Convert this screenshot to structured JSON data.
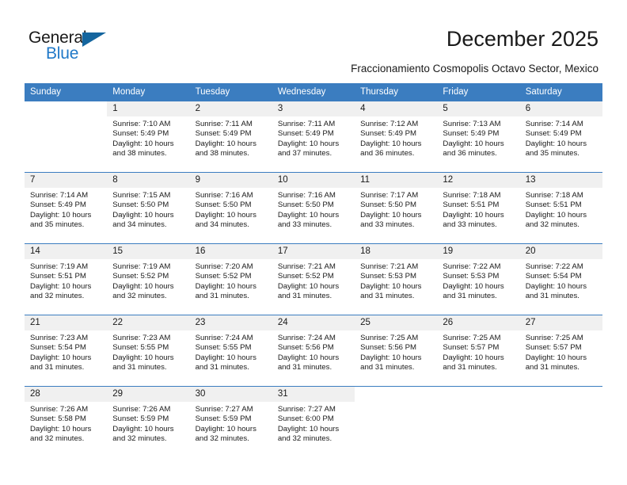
{
  "brand": {
    "name_top": "General",
    "name_bottom": "Blue",
    "accent_color": "#2079c8",
    "triangle_color": "#14659e"
  },
  "header": {
    "title": "December 2025",
    "subtitle": "Fraccionamiento Cosmopolis Octavo Sector, Mexico"
  },
  "theme": {
    "header_bg": "#3b7dc0",
    "header_text": "#ffffff",
    "daynum_bg": "#f0f0f0",
    "grid_line": "#3b7dc0",
    "text": "#1a1a1a"
  },
  "weekdays": [
    "Sunday",
    "Monday",
    "Tuesday",
    "Wednesday",
    "Thursday",
    "Friday",
    "Saturday"
  ],
  "weeks": [
    [
      {
        "day": "",
        "sunrise": "",
        "sunset": "",
        "daylight_line1": "",
        "daylight_line2": ""
      },
      {
        "day": "1",
        "sunrise": "Sunrise: 7:10 AM",
        "sunset": "Sunset: 5:49 PM",
        "daylight_line1": "Daylight: 10 hours",
        "daylight_line2": "and 38 minutes."
      },
      {
        "day": "2",
        "sunrise": "Sunrise: 7:11 AM",
        "sunset": "Sunset: 5:49 PM",
        "daylight_line1": "Daylight: 10 hours",
        "daylight_line2": "and 38 minutes."
      },
      {
        "day": "3",
        "sunrise": "Sunrise: 7:11 AM",
        "sunset": "Sunset: 5:49 PM",
        "daylight_line1": "Daylight: 10 hours",
        "daylight_line2": "and 37 minutes."
      },
      {
        "day": "4",
        "sunrise": "Sunrise: 7:12 AM",
        "sunset": "Sunset: 5:49 PM",
        "daylight_line1": "Daylight: 10 hours",
        "daylight_line2": "and 36 minutes."
      },
      {
        "day": "5",
        "sunrise": "Sunrise: 7:13 AM",
        "sunset": "Sunset: 5:49 PM",
        "daylight_line1": "Daylight: 10 hours",
        "daylight_line2": "and 36 minutes."
      },
      {
        "day": "6",
        "sunrise": "Sunrise: 7:14 AM",
        "sunset": "Sunset: 5:49 PM",
        "daylight_line1": "Daylight: 10 hours",
        "daylight_line2": "and 35 minutes."
      }
    ],
    [
      {
        "day": "7",
        "sunrise": "Sunrise: 7:14 AM",
        "sunset": "Sunset: 5:49 PM",
        "daylight_line1": "Daylight: 10 hours",
        "daylight_line2": "and 35 minutes."
      },
      {
        "day": "8",
        "sunrise": "Sunrise: 7:15 AM",
        "sunset": "Sunset: 5:50 PM",
        "daylight_line1": "Daylight: 10 hours",
        "daylight_line2": "and 34 minutes."
      },
      {
        "day": "9",
        "sunrise": "Sunrise: 7:16 AM",
        "sunset": "Sunset: 5:50 PM",
        "daylight_line1": "Daylight: 10 hours",
        "daylight_line2": "and 34 minutes."
      },
      {
        "day": "10",
        "sunrise": "Sunrise: 7:16 AM",
        "sunset": "Sunset: 5:50 PM",
        "daylight_line1": "Daylight: 10 hours",
        "daylight_line2": "and 33 minutes."
      },
      {
        "day": "11",
        "sunrise": "Sunrise: 7:17 AM",
        "sunset": "Sunset: 5:50 PM",
        "daylight_line1": "Daylight: 10 hours",
        "daylight_line2": "and 33 minutes."
      },
      {
        "day": "12",
        "sunrise": "Sunrise: 7:18 AM",
        "sunset": "Sunset: 5:51 PM",
        "daylight_line1": "Daylight: 10 hours",
        "daylight_line2": "and 33 minutes."
      },
      {
        "day": "13",
        "sunrise": "Sunrise: 7:18 AM",
        "sunset": "Sunset: 5:51 PM",
        "daylight_line1": "Daylight: 10 hours",
        "daylight_line2": "and 32 minutes."
      }
    ],
    [
      {
        "day": "14",
        "sunrise": "Sunrise: 7:19 AM",
        "sunset": "Sunset: 5:51 PM",
        "daylight_line1": "Daylight: 10 hours",
        "daylight_line2": "and 32 minutes."
      },
      {
        "day": "15",
        "sunrise": "Sunrise: 7:19 AM",
        "sunset": "Sunset: 5:52 PM",
        "daylight_line1": "Daylight: 10 hours",
        "daylight_line2": "and 32 minutes."
      },
      {
        "day": "16",
        "sunrise": "Sunrise: 7:20 AM",
        "sunset": "Sunset: 5:52 PM",
        "daylight_line1": "Daylight: 10 hours",
        "daylight_line2": "and 31 minutes."
      },
      {
        "day": "17",
        "sunrise": "Sunrise: 7:21 AM",
        "sunset": "Sunset: 5:52 PM",
        "daylight_line1": "Daylight: 10 hours",
        "daylight_line2": "and 31 minutes."
      },
      {
        "day": "18",
        "sunrise": "Sunrise: 7:21 AM",
        "sunset": "Sunset: 5:53 PM",
        "daylight_line1": "Daylight: 10 hours",
        "daylight_line2": "and 31 minutes."
      },
      {
        "day": "19",
        "sunrise": "Sunrise: 7:22 AM",
        "sunset": "Sunset: 5:53 PM",
        "daylight_line1": "Daylight: 10 hours",
        "daylight_line2": "and 31 minutes."
      },
      {
        "day": "20",
        "sunrise": "Sunrise: 7:22 AM",
        "sunset": "Sunset: 5:54 PM",
        "daylight_line1": "Daylight: 10 hours",
        "daylight_line2": "and 31 minutes."
      }
    ],
    [
      {
        "day": "21",
        "sunrise": "Sunrise: 7:23 AM",
        "sunset": "Sunset: 5:54 PM",
        "daylight_line1": "Daylight: 10 hours",
        "daylight_line2": "and 31 minutes."
      },
      {
        "day": "22",
        "sunrise": "Sunrise: 7:23 AM",
        "sunset": "Sunset: 5:55 PM",
        "daylight_line1": "Daylight: 10 hours",
        "daylight_line2": "and 31 minutes."
      },
      {
        "day": "23",
        "sunrise": "Sunrise: 7:24 AM",
        "sunset": "Sunset: 5:55 PM",
        "daylight_line1": "Daylight: 10 hours",
        "daylight_line2": "and 31 minutes."
      },
      {
        "day": "24",
        "sunrise": "Sunrise: 7:24 AM",
        "sunset": "Sunset: 5:56 PM",
        "daylight_line1": "Daylight: 10 hours",
        "daylight_line2": "and 31 minutes."
      },
      {
        "day": "25",
        "sunrise": "Sunrise: 7:25 AM",
        "sunset": "Sunset: 5:56 PM",
        "daylight_line1": "Daylight: 10 hours",
        "daylight_line2": "and 31 minutes."
      },
      {
        "day": "26",
        "sunrise": "Sunrise: 7:25 AM",
        "sunset": "Sunset: 5:57 PM",
        "daylight_line1": "Daylight: 10 hours",
        "daylight_line2": "and 31 minutes."
      },
      {
        "day": "27",
        "sunrise": "Sunrise: 7:25 AM",
        "sunset": "Sunset: 5:57 PM",
        "daylight_line1": "Daylight: 10 hours",
        "daylight_line2": "and 31 minutes."
      }
    ],
    [
      {
        "day": "28",
        "sunrise": "Sunrise: 7:26 AM",
        "sunset": "Sunset: 5:58 PM",
        "daylight_line1": "Daylight: 10 hours",
        "daylight_line2": "and 32 minutes."
      },
      {
        "day": "29",
        "sunrise": "Sunrise: 7:26 AM",
        "sunset": "Sunset: 5:59 PM",
        "daylight_line1": "Daylight: 10 hours",
        "daylight_line2": "and 32 minutes."
      },
      {
        "day": "30",
        "sunrise": "Sunrise: 7:27 AM",
        "sunset": "Sunset: 5:59 PM",
        "daylight_line1": "Daylight: 10 hours",
        "daylight_line2": "and 32 minutes."
      },
      {
        "day": "31",
        "sunrise": "Sunrise: 7:27 AM",
        "sunset": "Sunset: 6:00 PM",
        "daylight_line1": "Daylight: 10 hours",
        "daylight_line2": "and 32 minutes."
      },
      {
        "day": "",
        "sunrise": "",
        "sunset": "",
        "daylight_line1": "",
        "daylight_line2": ""
      },
      {
        "day": "",
        "sunrise": "",
        "sunset": "",
        "daylight_line1": "",
        "daylight_line2": ""
      },
      {
        "day": "",
        "sunrise": "",
        "sunset": "",
        "daylight_line1": "",
        "daylight_line2": ""
      }
    ]
  ]
}
